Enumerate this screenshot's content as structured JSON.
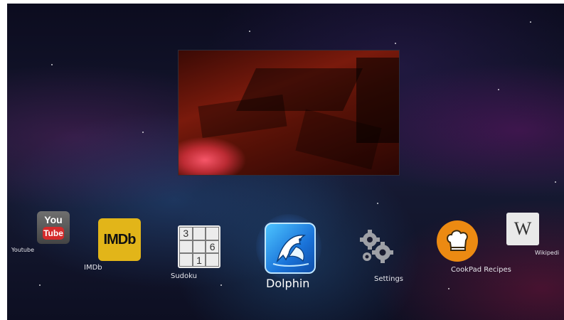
{
  "preview": {
    "content": "video-preview"
  },
  "apps": [
    {
      "label": "Youtube",
      "icon": "youtube-icon",
      "icon_you": "You",
      "icon_tube": "Tube"
    },
    {
      "label": "IMDb",
      "icon": "imdb-icon",
      "icon_text": "IMDb"
    },
    {
      "label": "Sudoku",
      "icon": "sudoku-icon",
      "cells": [
        "3",
        "",
        "",
        "",
        "",
        "6",
        "",
        "1",
        ""
      ]
    },
    {
      "label": "Dolphin",
      "icon": "dolphin-icon",
      "focused": true
    },
    {
      "label": "Settings",
      "icon": "gears-icon"
    },
    {
      "label": "CookPad Recipes",
      "icon": "chef-hat-icon"
    },
    {
      "label": "Wikipedi",
      "icon": "wikipedia-icon",
      "icon_text": "W"
    }
  ],
  "colors": {
    "imdb": "#e2b519",
    "youtube_red": "#d52b2b",
    "cookpad": "#ec8a12",
    "dolphin_blue": "#1a73d9"
  }
}
